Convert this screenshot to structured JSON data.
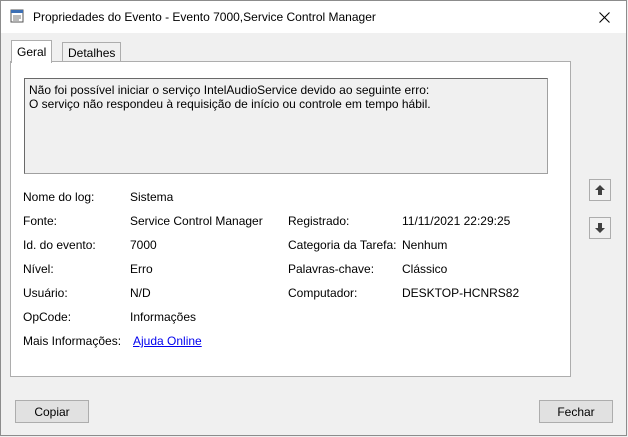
{
  "window": {
    "title": "Propriedades do Evento - Evento 7000,Service Control Manager"
  },
  "tabs": [
    {
      "label": "Geral",
      "active": true
    },
    {
      "label": "Detalhes",
      "active": false
    }
  ],
  "description": {
    "line1": "Não foi possível iniciar o serviço IntelAudioService devido ao seguinte erro:",
    "line2": "O serviço não respondeu à requisição de início ou controle em tempo hábil."
  },
  "fields": {
    "log_name": {
      "label": "Nome do log:",
      "value": "Sistema"
    },
    "source": {
      "label": "Fonte:",
      "value": "Service Control Manager"
    },
    "event_id": {
      "label": "Id. do evento:",
      "value": "7000"
    },
    "level": {
      "label": "Nível:",
      "value": "Erro"
    },
    "user": {
      "label": "Usuário:",
      "value": "N/D"
    },
    "opcode": {
      "label": "OpCode:",
      "value": "Informações"
    },
    "more_info": {
      "label": "Mais Informações:",
      "link": "Ajuda Online"
    },
    "logged": {
      "label": "Registrado:",
      "value": "11/11/2021 22:29:25"
    },
    "task_category": {
      "label": "Categoria da Tarefa:",
      "value": "Nenhum"
    },
    "keywords": {
      "label": "Palavras-chave:",
      "value": "Clássico"
    },
    "computer": {
      "label": "Computador:",
      "value": "DESKTOP-HCNRS82"
    }
  },
  "buttons": {
    "copy": "Copiar",
    "close": "Fechar"
  },
  "icons": {
    "title": "event-properties-icon",
    "close": "close-icon",
    "up": "arrow-up-icon",
    "down": "arrow-down-icon"
  },
  "colors": {
    "link": "#0000ee",
    "panel": "#ffffff",
    "background": "#f0f0f0"
  }
}
